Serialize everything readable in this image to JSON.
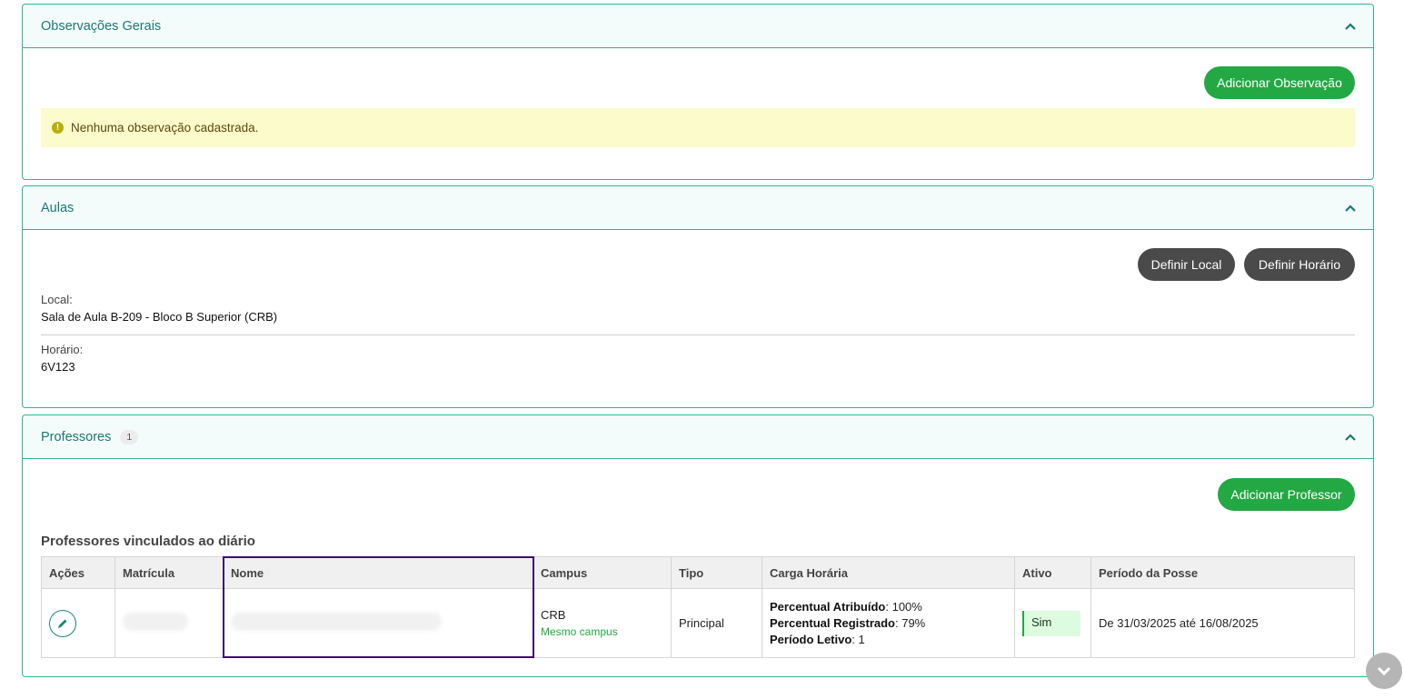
{
  "observacoes": {
    "title": "Observações Gerais",
    "add_button": "Adicionar Observação",
    "empty_message": "Nenhuma observação cadastrada."
  },
  "aulas": {
    "title": "Aulas",
    "local_button": "Definir Local",
    "horario_button": "Definir Horário",
    "local_label": "Local:",
    "local_value": "Sala de Aula B-209 - Bloco B Superior (CRB)",
    "horario_label": "Horário:",
    "horario_value": "6V123"
  },
  "professores": {
    "title": "Professores",
    "count": "1",
    "add_button": "Adicionar Professor",
    "table_title": "Professores vinculados ao diário",
    "columns": [
      "Ações",
      "Matrícula",
      "Nome",
      "Campus",
      "Tipo",
      "Carga Horária",
      "Ativo",
      "Período da Posse"
    ],
    "rows": [
      {
        "campus": "CRB",
        "campus_note": "Mesmo campus",
        "tipo": "Principal",
        "percentual_atribuido_label": "Percentual Atribuído",
        "percentual_atribuido": ": 100%",
        "percentual_registrado_label": "Percentual Registrado",
        "percentual_registrado": ": 79%",
        "periodo_letivo_label": "Período Letivo",
        "periodo_letivo": ": 1",
        "ativo": "Sim",
        "periodo_posse": "De 31/03/2025 até 16/08/2025"
      }
    ]
  },
  "icons": {
    "collapse": "chevron-up-icon",
    "edit": "pencil-icon",
    "warning": "exclamation-icon",
    "scroll": "chevron-down-icon"
  },
  "colors": {
    "accent": "#2fb58f",
    "primary_button": "#23a844",
    "dark_button": "#4a4a4a",
    "alert_bg": "#fcfbcc",
    "highlight_border": "#3c0f6e"
  }
}
